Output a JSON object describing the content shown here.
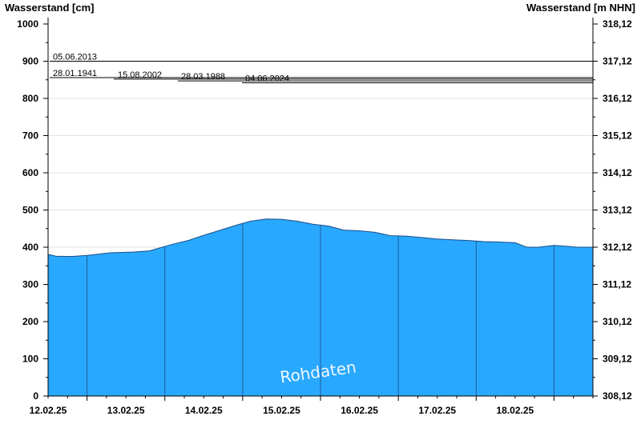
{
  "chart_data": {
    "type": "area",
    "title": "",
    "ylabel_left": "Wasserstand [cm]",
    "ylabel_right": "Wasserstand [m NHN]",
    "ylim": [
      0,
      1000
    ],
    "yticks_left": [
      {
        "value": 0,
        "label": "0"
      },
      {
        "value": 100,
        "label": "100"
      },
      {
        "value": 200,
        "label": "200"
      },
      {
        "value": 300,
        "label": "300"
      },
      {
        "value": 400,
        "label": "400"
      },
      {
        "value": 500,
        "label": "500"
      },
      {
        "value": 600,
        "label": "600"
      },
      {
        "value": 700,
        "label": "700"
      },
      {
        "value": 800,
        "label": "800"
      },
      {
        "value": 900,
        "label": "900"
      },
      {
        "value": 1000,
        "label": "1000"
      }
    ],
    "yticks_right": [
      {
        "value": 0,
        "label": "308,12"
      },
      {
        "value": 100,
        "label": "309,12"
      },
      {
        "value": 200,
        "label": "310,12"
      },
      {
        "value": 300,
        "label": "311,12"
      },
      {
        "value": 400,
        "label": "312,12"
      },
      {
        "value": 500,
        "label": "313,12"
      },
      {
        "value": 600,
        "label": "314,12"
      },
      {
        "value": 700,
        "label": "315,12"
      },
      {
        "value": 800,
        "label": "316,12"
      },
      {
        "value": 900,
        "label": "317,12"
      },
      {
        "value": 1000,
        "label": "318,12"
      }
    ],
    "xlim": [
      11.5,
      18.5
    ],
    "x_day_boundaries": [
      12,
      13,
      14,
      15,
      16,
      17,
      18
    ],
    "xticks": [
      {
        "value": 11.5,
        "label": "12.02.25"
      },
      {
        "value": 12.5,
        "label": "13.02.25"
      },
      {
        "value": 13.5,
        "label": "14.02.25"
      },
      {
        "value": 14.5,
        "label": "15.02.25"
      },
      {
        "value": 15.5,
        "label": "16.02.25"
      },
      {
        "value": 16.5,
        "label": "17.02.25"
      },
      {
        "value": 17.5,
        "label": "18.02.25"
      }
    ],
    "series": [
      {
        "name": "",
        "color": "#29a8ff",
        "x": [
          11.5,
          11.52,
          11.6,
          11.8,
          12.0,
          12.3,
          12.6,
          12.8,
          12.9,
          13.1,
          13.3,
          13.5,
          13.7,
          13.9,
          14.1,
          14.3,
          14.5,
          14.7,
          14.9,
          15.1,
          15.3,
          15.5,
          15.7,
          15.9,
          16.1,
          16.3,
          16.5,
          16.7,
          16.9,
          17.1,
          17.3,
          17.5,
          17.65,
          17.8,
          18.0,
          18.2,
          18.3,
          18.5
        ],
        "values": [
          378,
          380,
          376,
          375,
          378,
          385,
          387,
          390,
          396,
          408,
          418,
          432,
          445,
          458,
          470,
          476,
          475,
          470,
          462,
          457,
          446,
          444,
          440,
          431,
          430,
          426,
          422,
          420,
          418,
          415,
          414,
          412,
          400,
          400,
          405,
          402,
          400,
          400
        ]
      }
    ],
    "reference_lines": [
      {
        "date": "05.06.2013",
        "value": 900
      },
      {
        "date": "28.01.1941",
        "value": 856
      },
      {
        "date": "15.08.2002",
        "value": 852
      },
      {
        "date": "28.03.1988",
        "value": 847
      },
      {
        "date": "04.06.2024",
        "value": 842
      }
    ],
    "annotations": [
      "Rohdaten"
    ],
    "grid": true,
    "legend": "none"
  }
}
